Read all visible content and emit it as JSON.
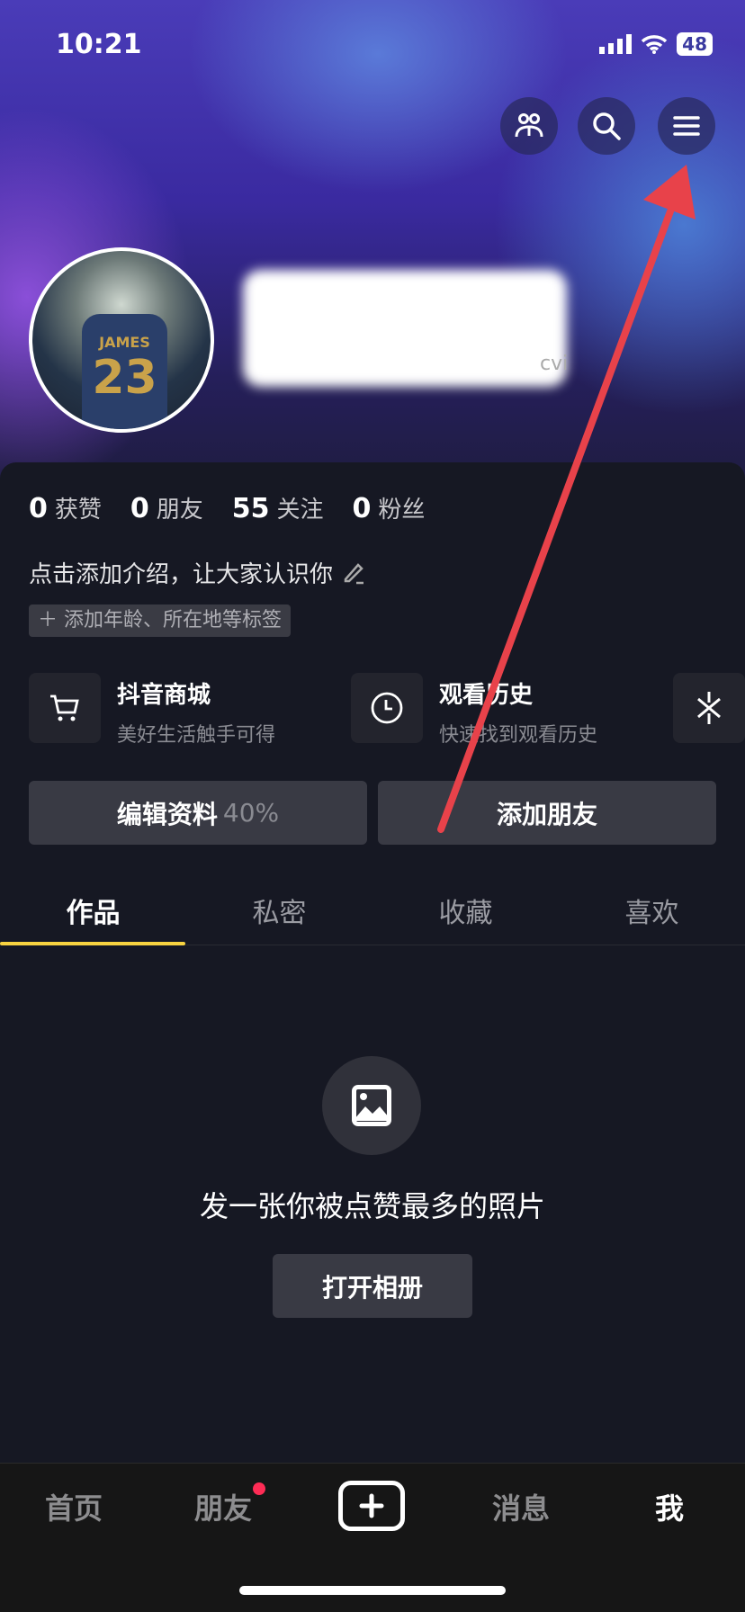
{
  "status": {
    "time": "10:21",
    "battery": "48"
  },
  "header": {
    "icons": [
      "friends-icon",
      "search-icon",
      "menu-icon"
    ]
  },
  "profile": {
    "id_suffix": "cvi"
  },
  "stats": [
    {
      "value": "0",
      "label": "获赞"
    },
    {
      "value": "0",
      "label": "朋友"
    },
    {
      "value": "55",
      "label": "关注"
    },
    {
      "value": "0",
      "label": "粉丝"
    }
  ],
  "intro": "点击添加介绍，让大家认识你",
  "tag": "＋ 添加年龄、所在地等标签",
  "shortcuts": [
    {
      "title": "抖音商城",
      "subtitle": "美好生活触手可得",
      "icon": "cart-icon"
    },
    {
      "title": "观看历史",
      "subtitle": "快速找到观看历史",
      "icon": "clock-icon"
    }
  ],
  "buttons": {
    "edit": "编辑资料",
    "edit_progress": "40%",
    "add_friend": "添加朋友"
  },
  "tabs": [
    "作品",
    "私密",
    "收藏",
    "喜欢"
  ],
  "empty": {
    "text": "发一张你被点赞最多的照片",
    "button": "打开相册"
  },
  "nav": [
    "首页",
    "朋友",
    "消息",
    "我"
  ],
  "colors": {
    "accent": "#f8d341",
    "badge": "#fe2c55",
    "annotation": "#e8424a"
  }
}
